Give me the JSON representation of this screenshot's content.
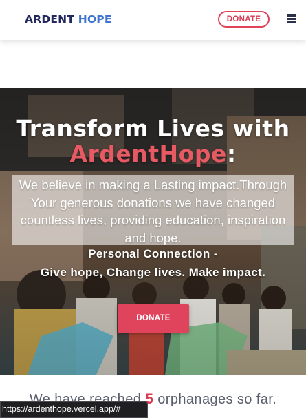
{
  "nav": {
    "logo_word1": "ARDENT",
    "logo_word2": "HOPE",
    "donate_label": "DONATE",
    "menu_icon": "hamburger-menu-icon"
  },
  "hero": {
    "title_line1": "Transform Lives with",
    "title_brand": "ArdentHope",
    "title_colon": ":",
    "intro": "We believe in making a Lasting impact.Through Your generous donations we have changed countless lives, providing education, inspiration and hope.",
    "tagline1": "Personal Connection -",
    "tagline2": "Give hope, Change lives. Make impact.",
    "donate_label": "DONATE"
  },
  "stats": {
    "prefix": "We have reached",
    "count": "5",
    "suffix": "orphanages so far."
  },
  "status_url": "https://ardenthope.vercel.app/#",
  "colors": {
    "brand_navy": "#23285e",
    "brand_blue": "#3f74cf",
    "accent_red": "#e0435c",
    "title_red": "#e85a63"
  }
}
